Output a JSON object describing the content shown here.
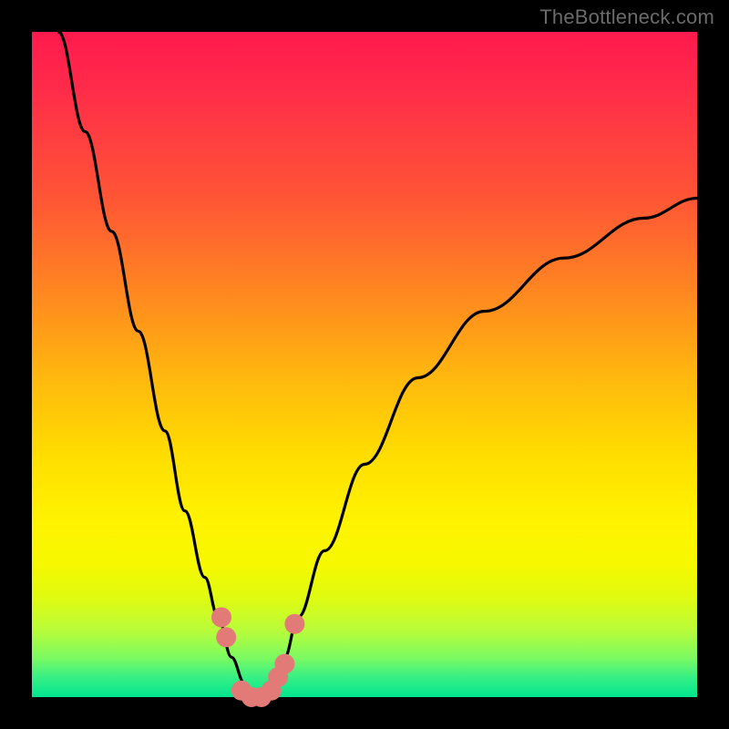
{
  "watermark": "TheBottleneck.com",
  "chart_data": {
    "type": "line",
    "title": "",
    "xlabel": "",
    "ylabel": "",
    "xlim": [
      0,
      100
    ],
    "ylim": [
      0,
      100
    ],
    "series": [
      {
        "name": "bottleneck-curve",
        "x": [
          4,
          8,
          12,
          16,
          20,
          23,
          26,
          28,
          30,
          32,
          33,
          34,
          35,
          36,
          38,
          40,
          44,
          50,
          58,
          68,
          80,
          92,
          100
        ],
        "values": [
          100,
          85,
          70,
          55,
          40,
          28,
          18,
          12,
          6,
          2,
          0,
          0,
          0,
          2,
          6,
          12,
          22,
          35,
          48,
          58,
          66,
          72,
          75
        ]
      }
    ],
    "markers": [
      {
        "name": "dot-left-upper",
        "x": 28.5,
        "y": 12
      },
      {
        "name": "dot-left-lower",
        "x": 29.2,
        "y": 9
      },
      {
        "name": "dot-bottom-1",
        "x": 31.5,
        "y": 1
      },
      {
        "name": "dot-bottom-2",
        "x": 33.0,
        "y": 0
      },
      {
        "name": "dot-bottom-3",
        "x": 34.5,
        "y": 0
      },
      {
        "name": "dot-bottom-4",
        "x": 36.0,
        "y": 1
      },
      {
        "name": "dot-bottom-5",
        "x": 37.0,
        "y": 3
      },
      {
        "name": "dot-bottom-6",
        "x": 38.0,
        "y": 5
      },
      {
        "name": "dot-right-upper",
        "x": 39.5,
        "y": 11
      }
    ],
    "colors": {
      "curve": "#000000",
      "markers": "#e27a78",
      "gradient_top": "#ff1a4d",
      "gradient_mid": "#ffde00",
      "gradient_bottom": "#00e58f"
    }
  }
}
